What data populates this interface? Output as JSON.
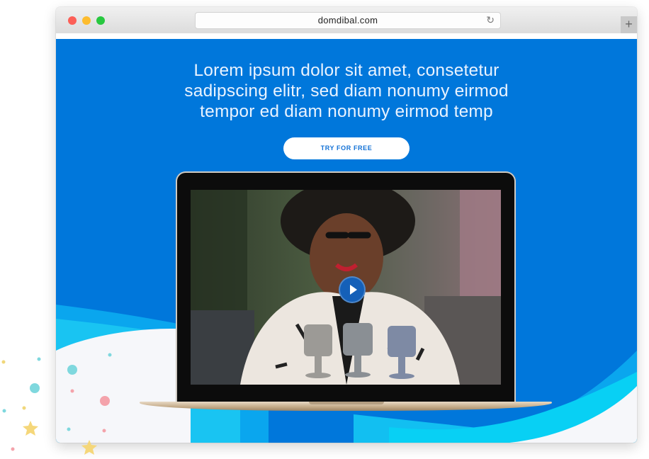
{
  "browser": {
    "url": "domdibal.com",
    "reload_icon": "reload-icon",
    "new_tab_icon": "plus-icon"
  },
  "hero": {
    "headline_line1": "Lorem ipsum dolor sit amet, consetetur",
    "headline_line2": "sadipscing elitr, sed diam nonumy eirmod",
    "headline_line3": "tempor ed diam nonumy eirmod temp",
    "cta_label": "TRY FOR FREE",
    "video_play_icon": "play-icon"
  },
  "colors": {
    "hero_background": "#0077db",
    "wave_cyan": "#00b8f0",
    "wave_light": "#f6f7fa",
    "accent_text": "#1170d6"
  }
}
